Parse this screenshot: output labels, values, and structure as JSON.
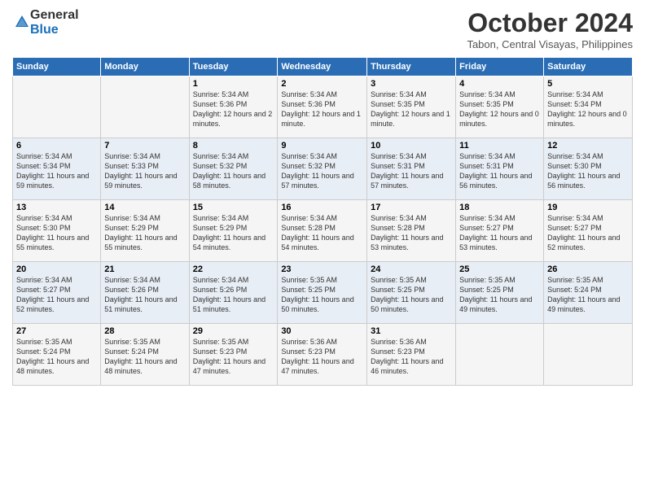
{
  "logo": {
    "general": "General",
    "blue": "Blue"
  },
  "title": "October 2024",
  "location": "Tabon, Central Visayas, Philippines",
  "days_header": [
    "Sunday",
    "Monday",
    "Tuesday",
    "Wednesday",
    "Thursday",
    "Friday",
    "Saturday"
  ],
  "weeks": [
    [
      {
        "day": "",
        "sunrise": "",
        "sunset": "",
        "daylight": ""
      },
      {
        "day": "",
        "sunrise": "",
        "sunset": "",
        "daylight": ""
      },
      {
        "day": "1",
        "sunrise": "Sunrise: 5:34 AM",
        "sunset": "Sunset: 5:36 PM",
        "daylight": "Daylight: 12 hours and 2 minutes."
      },
      {
        "day": "2",
        "sunrise": "Sunrise: 5:34 AM",
        "sunset": "Sunset: 5:36 PM",
        "daylight": "Daylight: 12 hours and 1 minute."
      },
      {
        "day": "3",
        "sunrise": "Sunrise: 5:34 AM",
        "sunset": "Sunset: 5:35 PM",
        "daylight": "Daylight: 12 hours and 1 minute."
      },
      {
        "day": "4",
        "sunrise": "Sunrise: 5:34 AM",
        "sunset": "Sunset: 5:35 PM",
        "daylight": "Daylight: 12 hours and 0 minutes."
      },
      {
        "day": "5",
        "sunrise": "Sunrise: 5:34 AM",
        "sunset": "Sunset: 5:34 PM",
        "daylight": "Daylight: 12 hours and 0 minutes."
      }
    ],
    [
      {
        "day": "6",
        "sunrise": "Sunrise: 5:34 AM",
        "sunset": "Sunset: 5:34 PM",
        "daylight": "Daylight: 11 hours and 59 minutes."
      },
      {
        "day": "7",
        "sunrise": "Sunrise: 5:34 AM",
        "sunset": "Sunset: 5:33 PM",
        "daylight": "Daylight: 11 hours and 59 minutes."
      },
      {
        "day": "8",
        "sunrise": "Sunrise: 5:34 AM",
        "sunset": "Sunset: 5:32 PM",
        "daylight": "Daylight: 11 hours and 58 minutes."
      },
      {
        "day": "9",
        "sunrise": "Sunrise: 5:34 AM",
        "sunset": "Sunset: 5:32 PM",
        "daylight": "Daylight: 11 hours and 57 minutes."
      },
      {
        "day": "10",
        "sunrise": "Sunrise: 5:34 AM",
        "sunset": "Sunset: 5:31 PM",
        "daylight": "Daylight: 11 hours and 57 minutes."
      },
      {
        "day": "11",
        "sunrise": "Sunrise: 5:34 AM",
        "sunset": "Sunset: 5:31 PM",
        "daylight": "Daylight: 11 hours and 56 minutes."
      },
      {
        "day": "12",
        "sunrise": "Sunrise: 5:34 AM",
        "sunset": "Sunset: 5:30 PM",
        "daylight": "Daylight: 11 hours and 56 minutes."
      }
    ],
    [
      {
        "day": "13",
        "sunrise": "Sunrise: 5:34 AM",
        "sunset": "Sunset: 5:30 PM",
        "daylight": "Daylight: 11 hours and 55 minutes."
      },
      {
        "day": "14",
        "sunrise": "Sunrise: 5:34 AM",
        "sunset": "Sunset: 5:29 PM",
        "daylight": "Daylight: 11 hours and 55 minutes."
      },
      {
        "day": "15",
        "sunrise": "Sunrise: 5:34 AM",
        "sunset": "Sunset: 5:29 PM",
        "daylight": "Daylight: 11 hours and 54 minutes."
      },
      {
        "day": "16",
        "sunrise": "Sunrise: 5:34 AM",
        "sunset": "Sunset: 5:28 PM",
        "daylight": "Daylight: 11 hours and 54 minutes."
      },
      {
        "day": "17",
        "sunrise": "Sunrise: 5:34 AM",
        "sunset": "Sunset: 5:28 PM",
        "daylight": "Daylight: 11 hours and 53 minutes."
      },
      {
        "day": "18",
        "sunrise": "Sunrise: 5:34 AM",
        "sunset": "Sunset: 5:27 PM",
        "daylight": "Daylight: 11 hours and 53 minutes."
      },
      {
        "day": "19",
        "sunrise": "Sunrise: 5:34 AM",
        "sunset": "Sunset: 5:27 PM",
        "daylight": "Daylight: 11 hours and 52 minutes."
      }
    ],
    [
      {
        "day": "20",
        "sunrise": "Sunrise: 5:34 AM",
        "sunset": "Sunset: 5:27 PM",
        "daylight": "Daylight: 11 hours and 52 minutes."
      },
      {
        "day": "21",
        "sunrise": "Sunrise: 5:34 AM",
        "sunset": "Sunset: 5:26 PM",
        "daylight": "Daylight: 11 hours and 51 minutes."
      },
      {
        "day": "22",
        "sunrise": "Sunrise: 5:34 AM",
        "sunset": "Sunset: 5:26 PM",
        "daylight": "Daylight: 11 hours and 51 minutes."
      },
      {
        "day": "23",
        "sunrise": "Sunrise: 5:35 AM",
        "sunset": "Sunset: 5:25 PM",
        "daylight": "Daylight: 11 hours and 50 minutes."
      },
      {
        "day": "24",
        "sunrise": "Sunrise: 5:35 AM",
        "sunset": "Sunset: 5:25 PM",
        "daylight": "Daylight: 11 hours and 50 minutes."
      },
      {
        "day": "25",
        "sunrise": "Sunrise: 5:35 AM",
        "sunset": "Sunset: 5:25 PM",
        "daylight": "Daylight: 11 hours and 49 minutes."
      },
      {
        "day": "26",
        "sunrise": "Sunrise: 5:35 AM",
        "sunset": "Sunset: 5:24 PM",
        "daylight": "Daylight: 11 hours and 49 minutes."
      }
    ],
    [
      {
        "day": "27",
        "sunrise": "Sunrise: 5:35 AM",
        "sunset": "Sunset: 5:24 PM",
        "daylight": "Daylight: 11 hours and 48 minutes."
      },
      {
        "day": "28",
        "sunrise": "Sunrise: 5:35 AM",
        "sunset": "Sunset: 5:24 PM",
        "daylight": "Daylight: 11 hours and 48 minutes."
      },
      {
        "day": "29",
        "sunrise": "Sunrise: 5:35 AM",
        "sunset": "Sunset: 5:23 PM",
        "daylight": "Daylight: 11 hours and 47 minutes."
      },
      {
        "day": "30",
        "sunrise": "Sunrise: 5:36 AM",
        "sunset": "Sunset: 5:23 PM",
        "daylight": "Daylight: 11 hours and 47 minutes."
      },
      {
        "day": "31",
        "sunrise": "Sunrise: 5:36 AM",
        "sunset": "Sunset: 5:23 PM",
        "daylight": "Daylight: 11 hours and 46 minutes."
      },
      {
        "day": "",
        "sunrise": "",
        "sunset": "",
        "daylight": ""
      },
      {
        "day": "",
        "sunrise": "",
        "sunset": "",
        "daylight": ""
      }
    ]
  ]
}
